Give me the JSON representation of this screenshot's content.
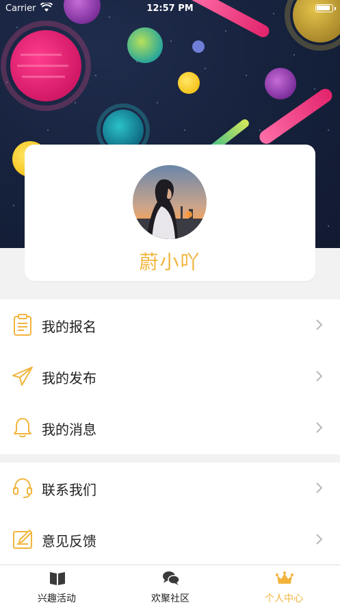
{
  "status_bar": {
    "carrier": "Carrier",
    "time": "12:57 PM"
  },
  "profile": {
    "username": "蔚小吖"
  },
  "menu": {
    "group1": [
      {
        "label": "我的报名",
        "icon": "clipboard-icon"
      },
      {
        "label": "我的发布",
        "icon": "paper-plane-icon"
      },
      {
        "label": "我的消息",
        "icon": "bell-icon"
      }
    ],
    "group2": [
      {
        "label": "联系我们",
        "icon": "headset-icon"
      },
      {
        "label": "意见反馈",
        "icon": "feedback-icon"
      }
    ]
  },
  "tabs": [
    {
      "label": "兴趣活动",
      "icon": "book-icon",
      "active": false
    },
    {
      "label": "欢聚社区",
      "icon": "chat-bubbles-icon",
      "active": false
    },
    {
      "label": "个人中心",
      "icon": "crown-icon",
      "active": true
    }
  ],
  "colors": {
    "accent": "#f2b43c",
    "banner_bg": "#15203a",
    "page_bg": "#f2f2f2"
  }
}
